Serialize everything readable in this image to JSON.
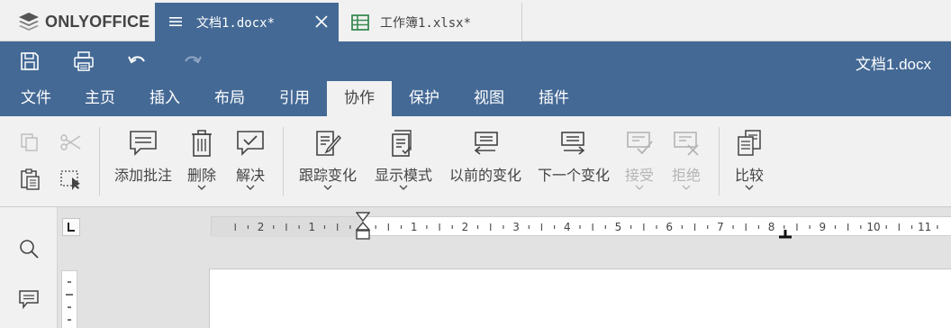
{
  "app": {
    "logo_text": "ONLYOFFICE"
  },
  "tabs": [
    {
      "label": "文档1.docx*",
      "icon": "document-icon",
      "active": true
    },
    {
      "label": "工作簿1.xlsx*",
      "icon": "spreadsheet-icon",
      "active": false
    }
  ],
  "header": {
    "doc_title": "文档1.docx"
  },
  "menu": {
    "items": [
      "文件",
      "主页",
      "插入",
      "布局",
      "引用",
      "协作",
      "保护",
      "视图",
      "插件"
    ],
    "active": "协作"
  },
  "toolbar": {
    "add_comment": "添加批注",
    "delete": "删除",
    "resolve": "解决",
    "track_changes": "跟踪变化",
    "display_mode": "显示模式",
    "previous_change": "以前的变化",
    "next_change": "下一个变化",
    "accept": "接受",
    "reject": "拒绝",
    "compare": "比较"
  },
  "ruler": {
    "left_labels": [
      "2",
      "1"
    ],
    "right_labels": [
      "1",
      "2",
      "3",
      "4",
      "5",
      "6",
      "7",
      "8",
      "9",
      "10",
      "11"
    ]
  },
  "colors": {
    "accent": "#446995",
    "toolbar_bg": "#f1f1f1",
    "disabled": "#b5b5b5"
  }
}
